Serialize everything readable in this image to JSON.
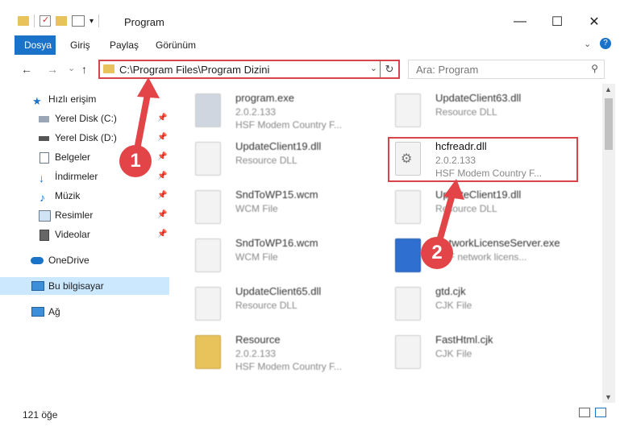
{
  "window": {
    "title": "Program",
    "minimize_glyph": "—",
    "maximize_glyph": "☐",
    "close_glyph": "✕"
  },
  "ribbon": {
    "tabs": [
      "Dosya",
      "Giriş",
      "Paylaş",
      "Görünüm"
    ],
    "help_glyph": "?"
  },
  "nav": {
    "back": "←",
    "forward": "→",
    "recent": "⌄",
    "up": "↑",
    "address": "C:\\Program Files\\Program Dizini",
    "address_dropdown": "⌄",
    "refresh": "↻",
    "search_placeholder": "Ara: Program",
    "search_icon": "⚲"
  },
  "sidebar": {
    "items": [
      {
        "label": "Hızlı erişim",
        "icon": "star-icon",
        "pinned": false
      },
      {
        "label": "Yerel Disk (C:)",
        "icon": "drive-icon",
        "pinned": true
      },
      {
        "label": "Yerel Disk (D:)",
        "icon": "drive-icon",
        "pinned": true
      },
      {
        "label": "Belgeler",
        "icon": "documents-icon",
        "pinned": true
      },
      {
        "label": "İndirmeler",
        "icon": "download-icon",
        "pinned": true
      },
      {
        "label": "Müzik",
        "icon": "music-icon",
        "pinned": true
      },
      {
        "label": "Resimler",
        "icon": "pictures-icon",
        "pinned": true
      },
      {
        "label": "Videolar",
        "icon": "videos-icon",
        "pinned": true
      },
      {
        "label": "OneDrive",
        "icon": "cloud-icon",
        "pinned": false
      },
      {
        "label": "Bu bilgisayar",
        "icon": "computer-icon",
        "pinned": false
      },
      {
        "label": "Ağ",
        "icon": "network-icon",
        "pinned": false
      }
    ],
    "pin_glyph": "📌"
  },
  "files": [
    {
      "name": "program.exe",
      "line2": "2.0.2.133",
      "line3": "HSF Modem Country F...",
      "kind": "exe-gear"
    },
    {
      "name": "UpdateClient63.dll",
      "line2": "Resource DLL",
      "line3": "",
      "kind": "doc"
    },
    {
      "name": "UpdateClient19.dll",
      "line2": "Resource DLL",
      "line3": "",
      "kind": "doc"
    },
    {
      "name": "hcfreadr.dll",
      "line2": "2.0.2.133",
      "line3": "HSF Modem Country F...",
      "kind": "dll"
    },
    {
      "name": "SndToWP15.wcm",
      "line2": "WCM File",
      "line3": "",
      "kind": "doc"
    },
    {
      "name": "UpdateClient19.dll",
      "line2": "Resource DLL",
      "line3": "",
      "kind": "doc"
    },
    {
      "name": "SndToWP16.wcm",
      "line2": "WCM File",
      "line3": "",
      "kind": "doc"
    },
    {
      "name": "NetworkLicenseServer.exe",
      "line2": "HSF network licens...",
      "line3": "",
      "kind": "exe"
    },
    {
      "name": "UpdateClient65.dll",
      "line2": "Resource DLL",
      "line3": "",
      "kind": "doc"
    },
    {
      "name": "gtd.cjk",
      "line2": "CJK File",
      "line3": "",
      "kind": "doc"
    },
    {
      "name": "Resource",
      "line2": "2.0.2.133",
      "line3": "HSF Modem Country F...",
      "kind": "folder"
    },
    {
      "name": "FastHtml.cjk",
      "line2": "CJK File",
      "line3": "",
      "kind": "doc"
    }
  ],
  "status": {
    "count": "121 öğe"
  },
  "annotations": {
    "badge1": "1",
    "badge2": "2",
    "accent": "#e24448"
  }
}
